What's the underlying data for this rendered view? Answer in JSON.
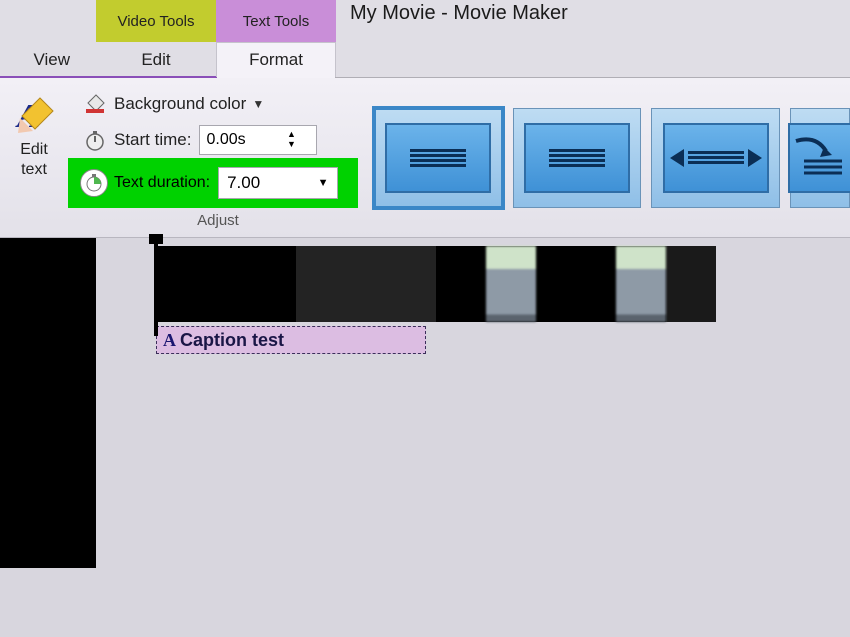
{
  "title": "My Movie - Movie Maker",
  "context_tabs": {
    "video": "Video Tools",
    "text": "Text Tools"
  },
  "menu": {
    "view": "View",
    "edit": "Edit",
    "format": "Format"
  },
  "edit_text_button": {
    "line1": "Edit",
    "line2": "text"
  },
  "adjust": {
    "bgcolor_label": "Background color",
    "start_time_label": "Start time:",
    "start_time_value": "0.00s",
    "text_duration_label": "Text duration:",
    "text_duration_value": "7.00",
    "group_label": "Adjust"
  },
  "caption": {
    "prefix": "A",
    "text": "Caption test"
  }
}
